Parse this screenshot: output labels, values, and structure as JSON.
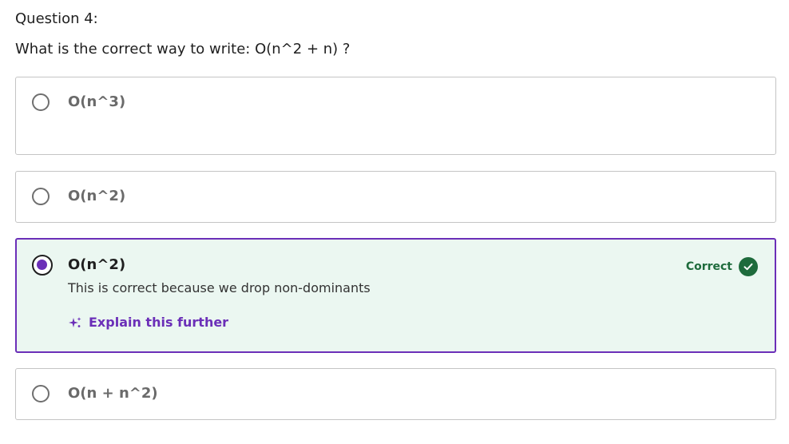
{
  "question": {
    "number_label": "Question 4:",
    "text": "What is the correct way to write:  O(n^2 + n) ?"
  },
  "options": [
    {
      "label": "O(n^3)",
      "selected": false
    },
    {
      "label": "O(n^2)",
      "selected": false
    },
    {
      "label": "O(n^2)",
      "selected": true,
      "status": "Correct",
      "feedback": "This is correct because we drop non-dominants",
      "explain_label": "Explain this further"
    },
    {
      "label": "O(n + n^2)",
      "selected": false
    }
  ],
  "colors": {
    "accent": "#6b2fb8",
    "correct": "#1e6b3c",
    "selected_background": "#ebf7f1"
  },
  "icons": {
    "radio_selected": "radio-selected-icon",
    "status": "check-circle-icon",
    "explain": "sparkle-icon"
  }
}
